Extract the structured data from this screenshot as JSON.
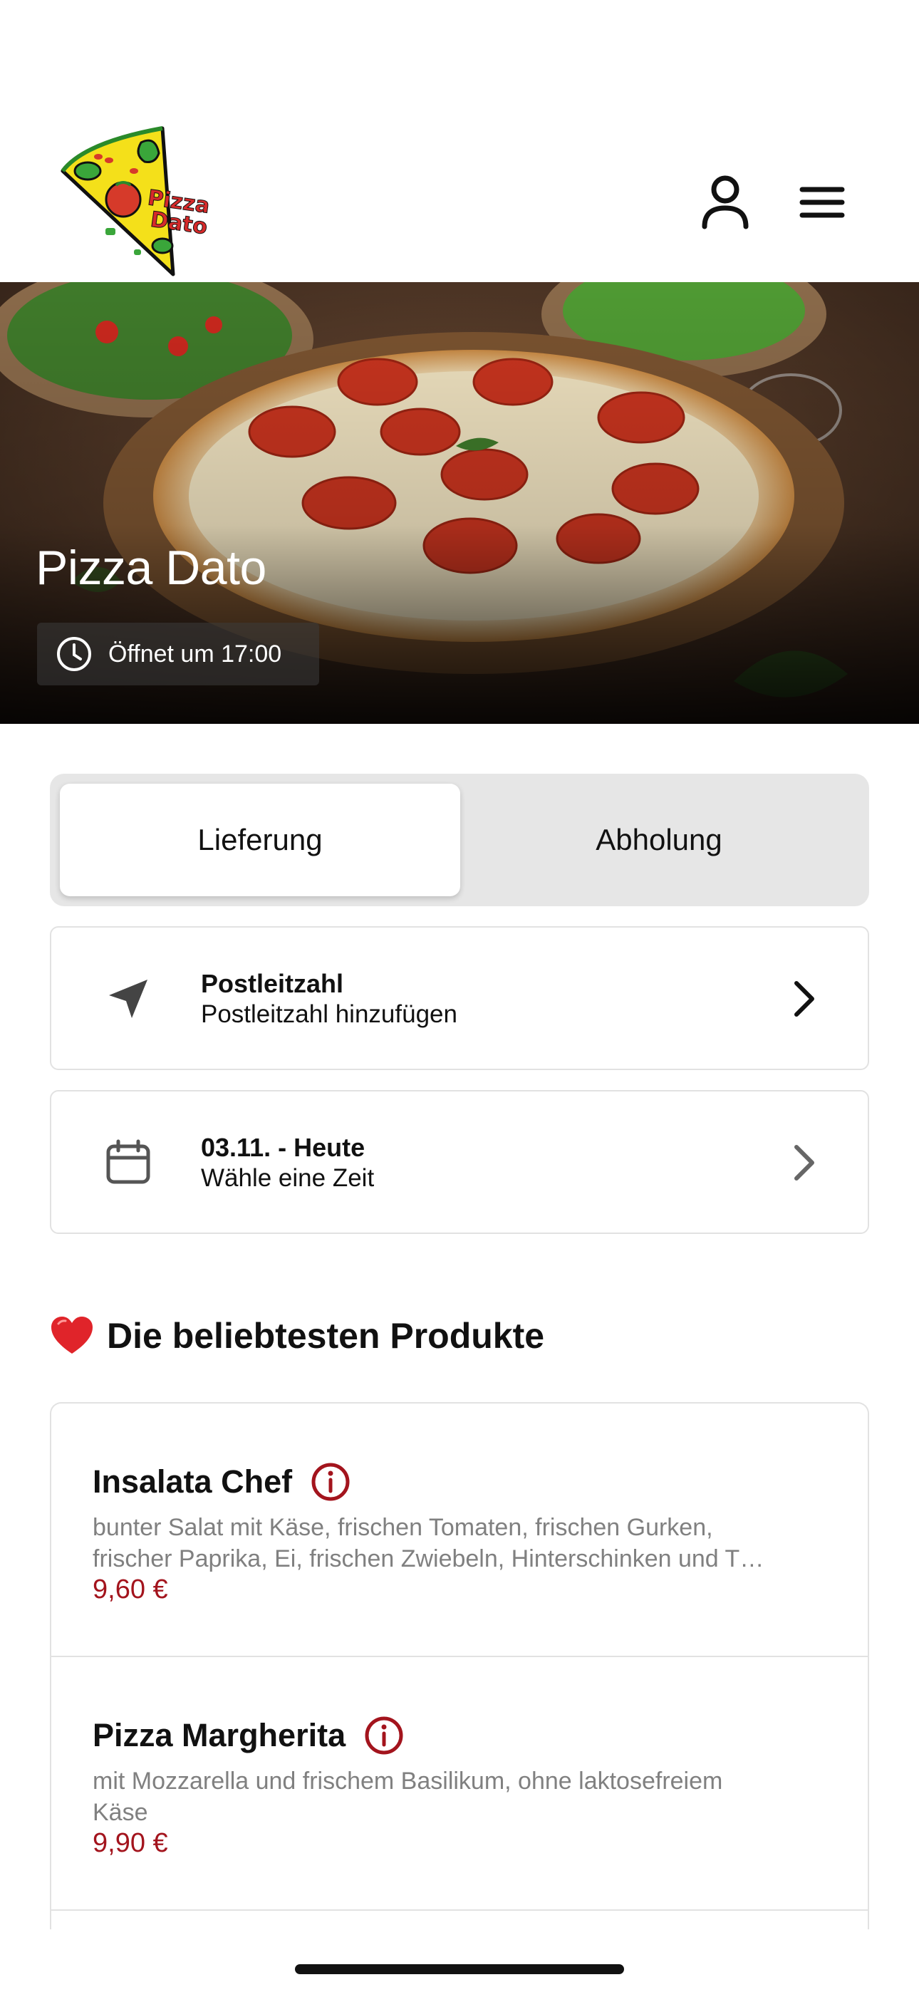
{
  "brand": {
    "logo_icon": "pizza-dato-logo",
    "logo_text_line1": "Pizza",
    "logo_text_line2": "Dato"
  },
  "header": {
    "user_icon": "user-icon",
    "menu_icon": "hamburger-menu-icon"
  },
  "hero": {
    "title": "Pizza Dato",
    "hours_icon": "clock-icon",
    "hours_text": "Öffnet um 17:00"
  },
  "order_mode": {
    "options": [
      {
        "label": "Lieferung",
        "selected": true
      },
      {
        "label": "Abholung",
        "selected": false
      }
    ]
  },
  "postcode": {
    "icon": "location-arrow-icon",
    "title": "Postleitzahl",
    "subtitle": "Postleitzahl hinzufügen"
  },
  "time_slot": {
    "icon": "calendar-icon",
    "title": "03.11. - Heute",
    "subtitle": "Wähle eine Zeit"
  },
  "popular": {
    "icon": "heart-icon",
    "title": "Die beliebtesten Produkte",
    "products": [
      {
        "name": "Insalata Chef",
        "desc_line1": "bunter Salat mit Käse, frischen Tomaten, frischen Gurken,",
        "desc_line2": "frischer Paprika, Ei, frischen Zwiebeln, Hinterschinken und T…",
        "price": "9,60 €"
      },
      {
        "name": "Pizza Margherita",
        "desc_line1": "mit Mozzarella und frischem Basilikum, ohne laktosefreiem",
        "desc_line2": "Käse",
        "price": "9,90 €"
      }
    ]
  },
  "colors": {
    "accent_red": "#a3141d",
    "segment_bg": "#e6e6e6",
    "border": "#e2e2e2"
  }
}
